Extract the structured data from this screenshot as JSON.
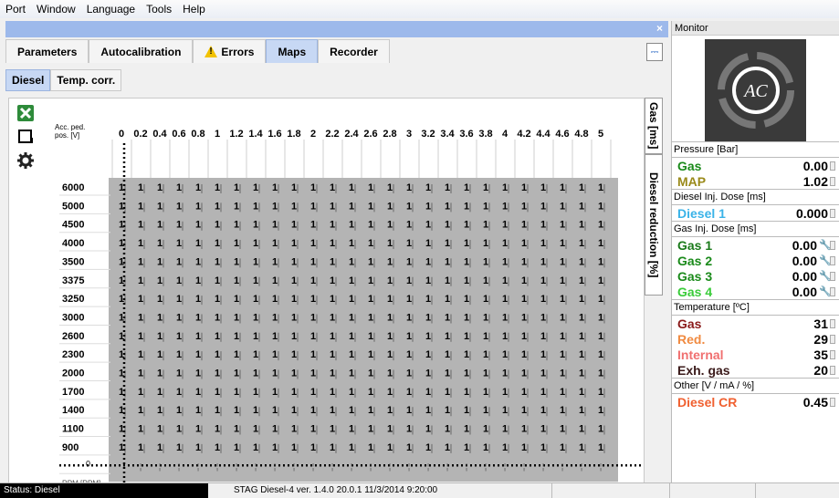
{
  "menu": [
    "Port",
    "Window",
    "Language",
    "Tools",
    "Help"
  ],
  "close_glyph": "×",
  "tabs": [
    {
      "label": "Parameters",
      "active": false
    },
    {
      "label": "Autocalibration",
      "active": false
    },
    {
      "label": "Errors",
      "active": false,
      "icon": "warning-icon"
    },
    {
      "label": "Maps",
      "active": true
    },
    {
      "label": "Recorder",
      "active": false
    }
  ],
  "subtabs": [
    {
      "label": "Diesel",
      "active": true
    },
    {
      "label": "Temp. corr.",
      "active": false
    }
  ],
  "vtabs": [
    "Gas [ms]",
    "Diesel reduction [%]"
  ],
  "map": {
    "x_axis_label": "Acc. ped. pos. [V]",
    "y_axis_label": "RPM [RPM]",
    "x_values": [
      "0",
      "0.2",
      "0.4",
      "0.6",
      "0.8",
      "1",
      "1.2",
      "1.4",
      "1.6",
      "1.8",
      "2",
      "2.2",
      "2.4",
      "2.6",
      "2.8",
      "3",
      "3.2",
      "3.4",
      "3.6",
      "3.8",
      "4",
      "4.2",
      "4.4",
      "4.6",
      "4.8",
      "5"
    ],
    "y_values": [
      "6000",
      "5000",
      "4500",
      "4000",
      "3500",
      "3375",
      "3250",
      "3000",
      "2600",
      "2300",
      "2000",
      "1700",
      "1400",
      "1100",
      "900",
      "0"
    ],
    "cell_value": "1",
    "cursor_x_index": 0,
    "cursor_y_index": 15,
    "cursor_value": "0"
  },
  "monitor": {
    "title": "Monitor",
    "sections": [
      {
        "label": "Pressure [Bar]",
        "rows": [
          {
            "name": "Gas",
            "value": "0.00",
            "color": "#1a8a1a"
          },
          {
            "name": "MAP",
            "value": "1.02",
            "color": "#9a8a1a"
          }
        ]
      },
      {
        "label": "Diesel Inj. Dose [ms]",
        "rows": [
          {
            "name": "Diesel 1",
            "value": "0.000",
            "color": "#3ab3e8"
          }
        ]
      },
      {
        "label": "Gas Inj. Dose [ms]",
        "rows": [
          {
            "name": "Gas 1",
            "value": "0.00",
            "color": "#1a7a1a",
            "wrench": true
          },
          {
            "name": "Gas 2",
            "value": "0.00",
            "color": "#1a8a1a",
            "wrench": true
          },
          {
            "name": "Gas 3",
            "value": "0.00",
            "color": "#1a8a1a",
            "wrench": true
          },
          {
            "name": "Gas 4",
            "value": "0.00",
            "color": "#3acc3a",
            "wrench": true
          }
        ]
      },
      {
        "label": "Temperature [ºC]",
        "rows": [
          {
            "name": "Gas",
            "value": "31",
            "color": "#8a1a1a"
          },
          {
            "name": "Red.",
            "value": "29",
            "color": "#f08a40"
          },
          {
            "name": "Internal",
            "value": "35",
            "color": "#f07070"
          },
          {
            "name": "Exh. gas",
            "value": "20",
            "color": "#3a1a1a"
          }
        ]
      },
      {
        "label": "Other [V / mA / %]",
        "rows": [
          {
            "name": "Diesel CR",
            "value": "0.45",
            "color": "#f06030"
          }
        ]
      }
    ]
  },
  "status": {
    "label": "Status: Diesel",
    "version": "STAG Diesel-4  ver. 1.4.0  20.0.1  11/3/2014 9:20:00"
  }
}
